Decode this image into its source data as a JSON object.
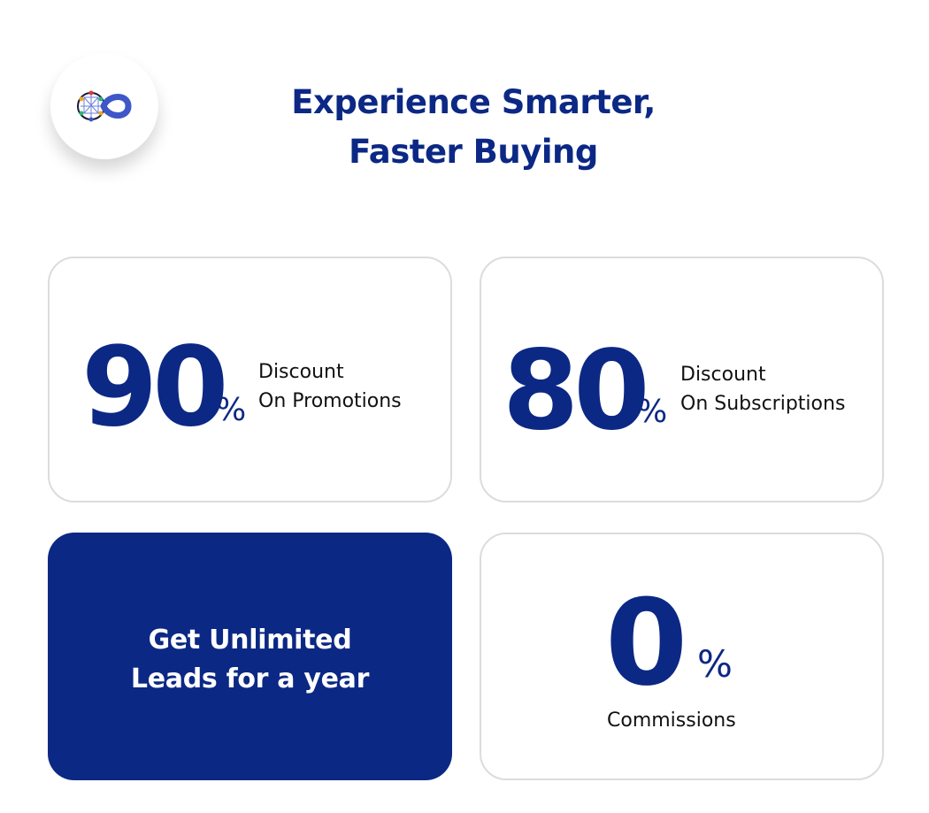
{
  "logo": {
    "icon": "infinity-network-logo",
    "colors": [
      "#3d57c8",
      "#0c2885",
      "#f2a71b",
      "#2bb673",
      "#e03a3a"
    ]
  },
  "headline": {
    "line1": "Experience Smarter,",
    "line2": "Faster Buying"
  },
  "stats": [
    {
      "value": "90",
      "unit": "%",
      "line1": "Discount",
      "line2": "On Promotions"
    },
    {
      "value": "80",
      "unit": "%",
      "line1": "Discount",
      "line2": "On Subscriptions"
    },
    {
      "value": "0",
      "unit": "%",
      "line1": "Commissions"
    }
  ],
  "promo": {
    "line1": "Get Unlimited",
    "line2": "Leads for a year"
  },
  "colors": {
    "brand": "#0c2885",
    "border": "#dcdcdc",
    "text": "#111111",
    "white": "#ffffff"
  }
}
